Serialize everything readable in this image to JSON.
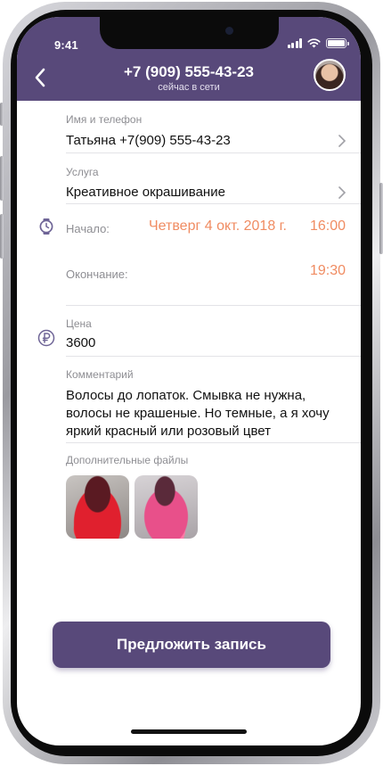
{
  "status_bar": {
    "time": "9:41"
  },
  "header": {
    "phone": "+7 (909) 555-43-23",
    "presence": "сейчас в сети"
  },
  "form": {
    "name_phone": {
      "label": "Имя и телефон",
      "value": "Татьяна +7(909) 555-43-23"
    },
    "service": {
      "label": "Услуга",
      "value": "Креативное окрашивание"
    },
    "start": {
      "label": "Начало:",
      "date": "Четверг 4 окт. 2018 г.",
      "time": "16:00"
    },
    "end": {
      "label": "Окончание:",
      "time": "19:30"
    },
    "price": {
      "label": "Цена",
      "value": "3600"
    },
    "comment": {
      "label": "Комментарий",
      "value": "Волосы до лопаток. Смывка не нужна, волосы не крашеные. Но темные, а я хочу яркий красный или розовый цвет"
    },
    "files": {
      "label": "Дополнительные файлы",
      "count": 2
    }
  },
  "actions": {
    "propose_label": "Предложить запись"
  },
  "colors": {
    "brand": "#58497a",
    "accent": "#f08c62",
    "text": "#111111",
    "muted": "#8e8e93"
  }
}
